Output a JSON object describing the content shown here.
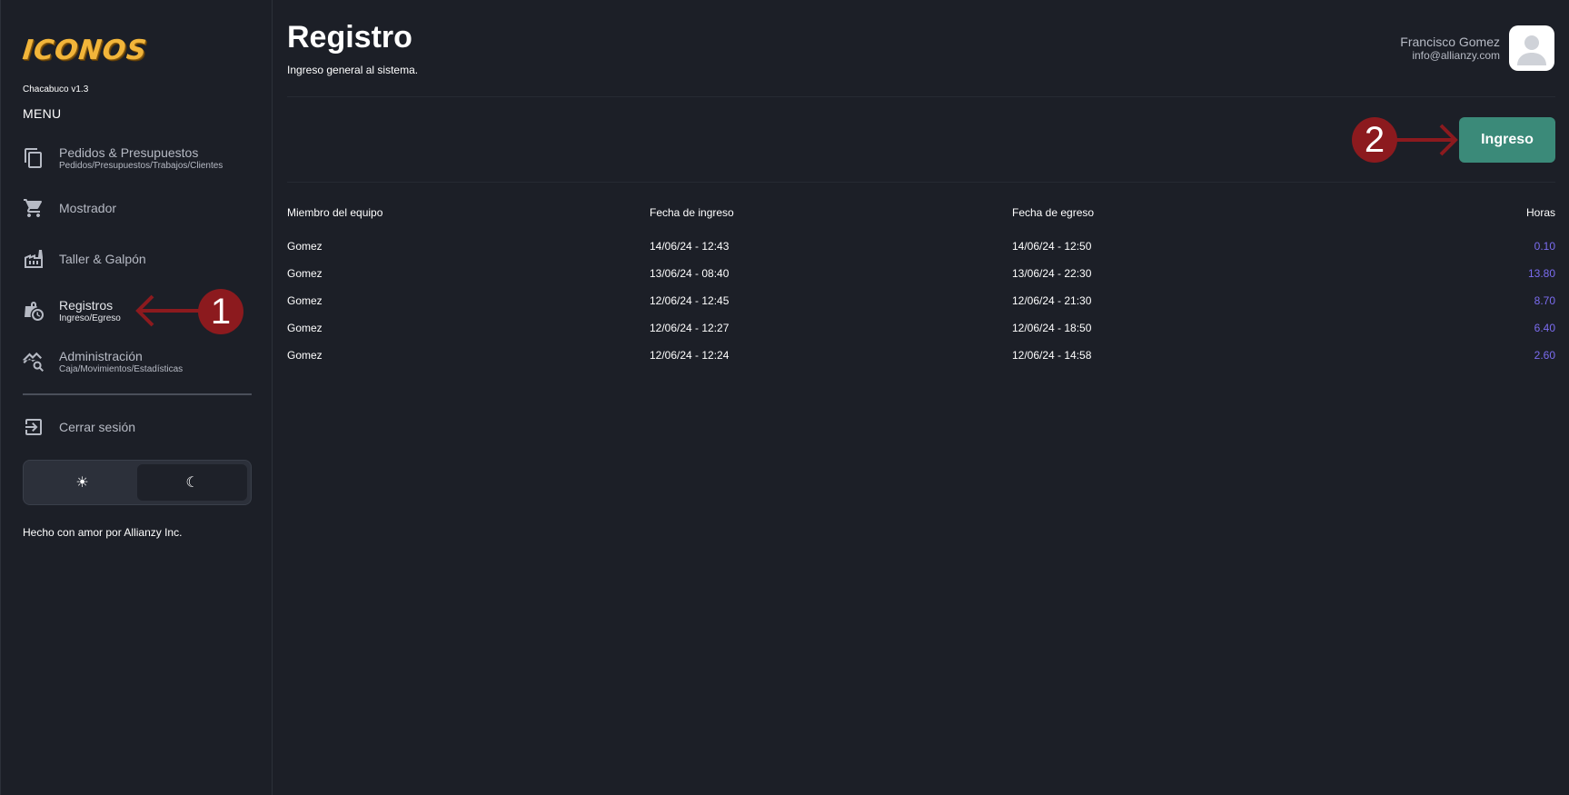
{
  "sidebar": {
    "logo": "ICONOS",
    "version": "Chacabuco v1.3",
    "menu_title": "MENU",
    "items": [
      {
        "label": "Pedidos & Presupuestos",
        "sub": "Pedidos/Presupuestos/Trabajos/Clientes",
        "icon": "copy-icon"
      },
      {
        "label": "Mostrador",
        "sub": "",
        "icon": "cart-icon"
      },
      {
        "label": "Taller & Galpón",
        "sub": "",
        "icon": "factory-icon"
      },
      {
        "label": "Registros",
        "sub": "Ingreso/Egreso",
        "icon": "clock-bag-icon"
      },
      {
        "label": "Administración",
        "sub": "Caja/Movimientos/Estadísticas",
        "icon": "chart-search-icon"
      }
    ],
    "logout_label": "Cerrar sesión",
    "theme": {
      "light_icon": "☀",
      "dark_icon": "☾",
      "selected": "dark"
    },
    "footer": "Hecho con amor por Allianzy Inc."
  },
  "header": {
    "title": "Registro",
    "subtitle": "Ingreso general al sistema.",
    "user_name": "Francisco Gomez",
    "user_email": "info@allianzy.com"
  },
  "actions": {
    "ingreso_label": "Ingreso"
  },
  "table": {
    "columns": [
      "Miembro del equipo",
      "Fecha de ingreso",
      "Fecha de egreso",
      "Horas"
    ],
    "rows": [
      [
        "Gomez",
        "14/06/24 - 12:43",
        "14/06/24 - 12:50",
        "0.10"
      ],
      [
        "Gomez",
        "13/06/24 - 08:40",
        "13/06/24 - 22:30",
        "13.80"
      ],
      [
        "Gomez",
        "12/06/24 - 12:45",
        "12/06/24 - 21:30",
        "8.70"
      ],
      [
        "Gomez",
        "12/06/24 - 12:27",
        "12/06/24 - 18:50",
        "6.40"
      ],
      [
        "Gomez",
        "12/06/24 - 12:24",
        "12/06/24 - 14:58",
        "2.60"
      ]
    ]
  },
  "annotations": {
    "marker1": "1",
    "marker2": "2"
  },
  "colors": {
    "background": "#1c1f27",
    "accent_button": "#3b8a79",
    "hours_text": "#7b6cf0",
    "annotation": "#8c1a1e",
    "logo": "#f2b53a"
  }
}
